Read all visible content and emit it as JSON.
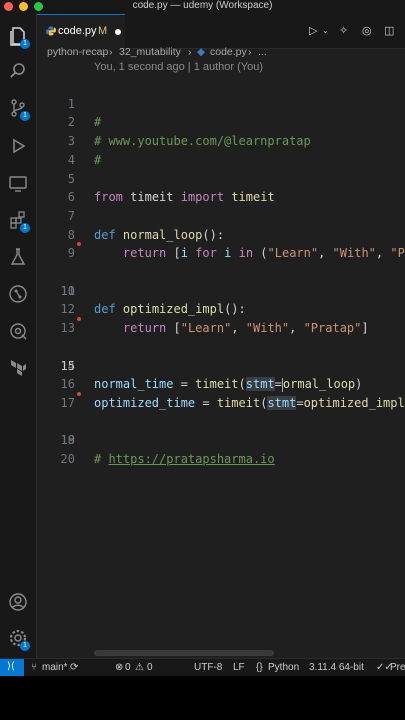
{
  "window": {
    "title": "code.py — udemy (Workspace)"
  },
  "activity_bar": {
    "badges": {
      "explorer": "1",
      "source_control": "1",
      "extensions": "1",
      "settings": "1"
    }
  },
  "tab": {
    "label": "code.py",
    "modified_flag": "M"
  },
  "breadcrumb": [
    "python-recap",
    "32_mutability",
    "code.py",
    "..."
  ],
  "editor": {
    "blame": "You, 1 second ago | 1 author (You)",
    "active_line": 15,
    "lines": [
      {
        "num": "1",
        "text": "#"
      },
      {
        "num": "2",
        "text": "# www.youtube.com/@learnpratap"
      },
      {
        "num": "3",
        "text": "#"
      },
      {
        "num": "4",
        "text": ""
      },
      {
        "num": "5",
        "text": "from timeit import timeit"
      },
      {
        "num": "6",
        "text": ""
      },
      {
        "num": "7",
        "text": "def normal_loop():"
      },
      {
        "num": "8",
        "text": "    return [i for i in (\"Learn\", \"With\", \"Pr"
      },
      {
        "num": "9",
        "text": ""
      },
      {
        "num": "10",
        "text": ""
      },
      {
        "num": "11",
        "text": "def optimized_impl():"
      },
      {
        "num": "12",
        "text": "    return [\"Learn\", \"With\", \"Pratap\"]"
      },
      {
        "num": "13",
        "text": ""
      },
      {
        "num": "14",
        "text": ""
      },
      {
        "num": "15",
        "text": "normal_time = timeit(stmt=normal_loop)"
      },
      {
        "num": "16",
        "text": "optimized_time = timeit(stmt=optimized_impl)"
      },
      {
        "num": "17",
        "text": ""
      },
      {
        "num": "18",
        "text": ""
      },
      {
        "num": "19",
        "text": "# https://pratapsharma.io"
      },
      {
        "num": "20",
        "text": ""
      }
    ],
    "tokens": {
      "l2_comment": "# www.youtube.com/@learnpratap",
      "hash": "#",
      "from": "from",
      "timeit": "timeit",
      "import": "import",
      "def": "def",
      "normal_loop": "normal_loop",
      "optimized_impl": "optimized_impl",
      "parens_colon": "():",
      "indent": "    ",
      "return": "return",
      "lbracket": "[",
      "i": "i",
      "for": "for",
      "in": "in",
      "lparen": "(",
      "learn": "\"Learn\"",
      "comma_sp": ", ",
      "with": "\"With\"",
      "pr": "\"Pr",
      "pratap": "\"Pratap\"",
      "rbracket": "]",
      "normal_time": "normal_time",
      "optimized_time": "optimized_time",
      "eq": " = ",
      "stmt": "stmt",
      "eq2": "=",
      "rparen": ")",
      "normal_loop_tail": "ormal_loop",
      "n_char": "n",
      "hash_sp": "# ",
      "url": "https://pratapsharma.io",
      "sp": " "
    }
  },
  "status_bar": {
    "branch": "main*",
    "errors": "0",
    "warnings": "0",
    "encoding": "UTF-8",
    "eol": "LF",
    "language": "Python",
    "interpreter": "3.11.4 64-bit",
    "prettier": "Pre"
  },
  "colors": {
    "accent": "#0078d4",
    "comment": "#6a9955",
    "keyword": "#c586c0",
    "function": "#dcdcaa",
    "string": "#ce9178"
  }
}
